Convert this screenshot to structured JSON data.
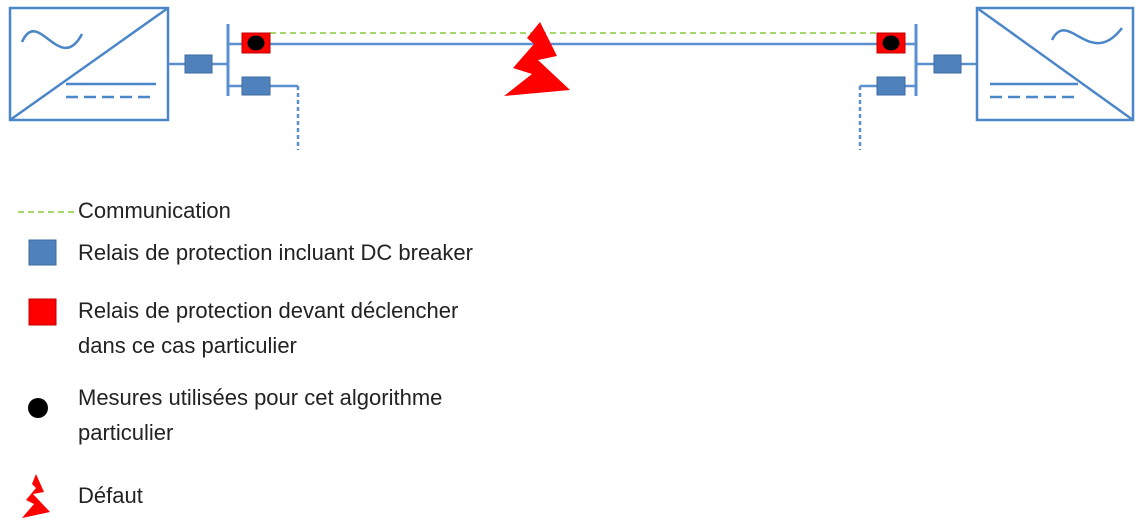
{
  "colors": {
    "line": "#5b8fd0",
    "relay_blue": "#4f81bd",
    "relay_red": "#ff0000",
    "relay_red_border": "#c00000",
    "measure_dot": "#000000",
    "communication": "#9bd35a",
    "fault": "#ff0000",
    "converter": "#4a86c8"
  },
  "icons": {
    "converter": "converter-icon",
    "relay": "relay-square-icon",
    "measure": "measure-dot-icon",
    "fault": "lightning-bolt-icon"
  },
  "legend": {
    "communication": "Communication",
    "relay_dc_breaker": "Relais de protection incluant  DC breaker",
    "relay_trip_line1": "Relais de protection devant déclencher",
    "relay_trip_line2": "dans ce cas particulier",
    "measures_line1": "Mesures utilisées pour cet algorithme",
    "measures_line2": "particulier",
    "fault": "Défaut"
  }
}
